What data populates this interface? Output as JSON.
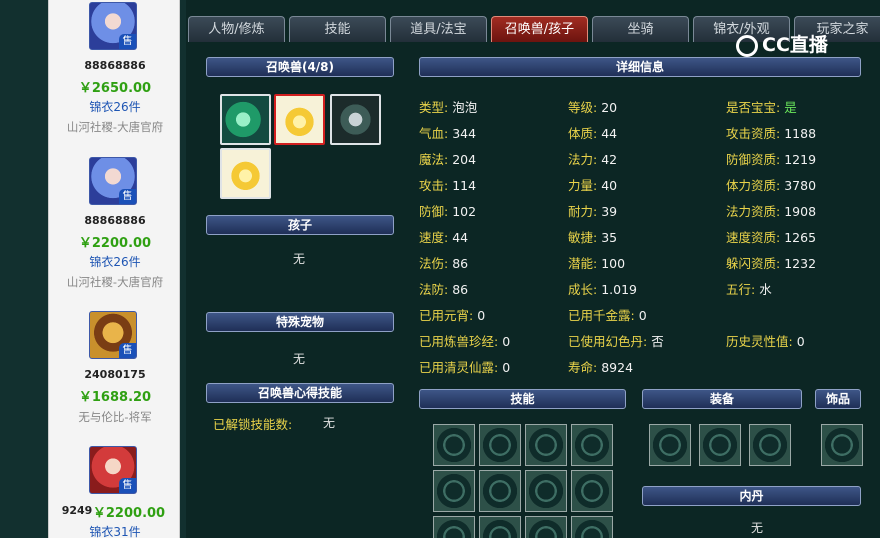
{
  "listings": [
    {
      "account": "88868886",
      "price": "￥2650.00",
      "items": "锦衣26件",
      "server": "山河社稷-大唐官府",
      "sell_badge": "售",
      "avatar_style": "blue"
    },
    {
      "account": "88868886",
      "price": "￥2200.00",
      "items": "锦衣26件",
      "server": "山河社稷-大唐官府",
      "sell_badge": "售",
      "avatar_style": "blue"
    },
    {
      "account": "24080175",
      "price": "￥1688.20",
      "items": "",
      "server": "无与伦比-将军",
      "sell_badge": "售",
      "avatar_style": "gold"
    },
    {
      "account": "9249",
      "price": "￥2200.00",
      "items": "锦衣31件",
      "server": "",
      "sell_badge": "售",
      "avatar_style": "red"
    }
  ],
  "tabs": [
    "人物/修炼",
    "技能",
    "道具/法宝",
    "召唤兽/孩子",
    "坐骑",
    "锦衣/外观",
    "玩家之家"
  ],
  "active_tab": 3,
  "summon_panel": {
    "title": "召唤兽(4/8)"
  },
  "child_panel": {
    "title": "孩子",
    "value": "无"
  },
  "special_pet_panel": {
    "title": "特殊宠物",
    "value": "无"
  },
  "skill_insight_panel": {
    "title": "召唤兽心得技能",
    "label": "已解锁技能数:",
    "value": "无"
  },
  "detail": {
    "title": "详细信息",
    "rows": [
      [
        {
          "label": "类型:",
          "value": "泡泡"
        },
        {
          "label": "等级:",
          "value": "20"
        },
        {
          "label": "是否宝宝:",
          "value": "是",
          "highlight": true
        }
      ],
      [
        {
          "label": "气血:",
          "value": "344"
        },
        {
          "label": "体质:",
          "value": "44"
        },
        {
          "label": "攻击资质:",
          "value": "1188"
        }
      ],
      [
        {
          "label": "魔法:",
          "value": "204"
        },
        {
          "label": "法力:",
          "value": "42"
        },
        {
          "label": "防御资质:",
          "value": "1219"
        }
      ],
      [
        {
          "label": "攻击:",
          "value": "114"
        },
        {
          "label": "力量:",
          "value": "40"
        },
        {
          "label": "体力资质:",
          "value": "3780"
        }
      ],
      [
        {
          "label": "防御:",
          "value": "102"
        },
        {
          "label": "耐力:",
          "value": "39"
        },
        {
          "label": "法力资质:",
          "value": "1908"
        }
      ],
      [
        {
          "label": "速度:",
          "value": "44"
        },
        {
          "label": "敏捷:",
          "value": "35"
        },
        {
          "label": "速度资质:",
          "value": "1265"
        }
      ],
      [
        {
          "label": "法伤:",
          "value": "86"
        },
        {
          "label": "潜能:",
          "value": "100"
        },
        {
          "label": "躲闪资质:",
          "value": "1232"
        }
      ],
      [
        {
          "label": "法防:",
          "value": "86"
        },
        {
          "label": "成长:",
          "value": "1.019"
        },
        {
          "label": "五行:",
          "value": "水"
        }
      ],
      [
        {
          "label": "已用元宵:",
          "value": "0"
        },
        {
          "label": "已用千金露:",
          "value": "0"
        },
        null
      ],
      [
        {
          "label": "已用炼兽珍经:",
          "value": "0"
        },
        {
          "label": "已使用幻色丹:",
          "value": "否"
        },
        {
          "label": "历史灵性值:",
          "value": "0"
        }
      ],
      [
        {
          "label": "已用清灵仙露:",
          "value": "0"
        },
        {
          "label": "寿命:",
          "value": "8924"
        },
        null
      ]
    ]
  },
  "skills_panel": {
    "title": "技能"
  },
  "equipment_panel": {
    "title": "装备"
  },
  "ornament_panel": {
    "title": "饰品"
  },
  "neidan_panel": {
    "title": "内丹",
    "value": "无"
  },
  "watermark": {
    "text": "CC直播"
  },
  "colors": {
    "active_tab": "#a12c22",
    "price_green": "#2fa012",
    "label_yellow": "#e9d34a",
    "panel_blue": "#2c4273"
  }
}
